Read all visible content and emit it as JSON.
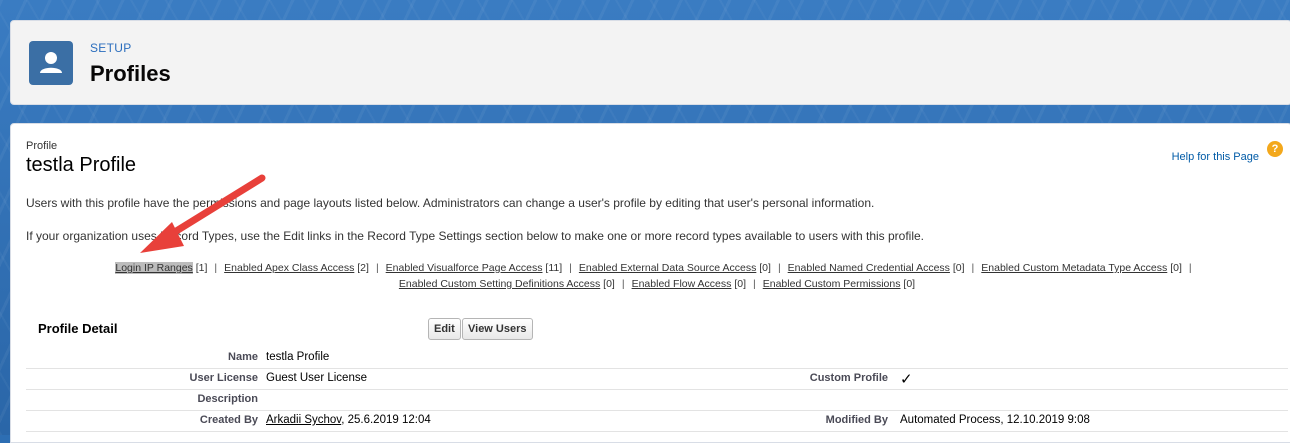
{
  "header": {
    "setup_label": "SETUP",
    "title": "Profiles",
    "icon": "user-icon"
  },
  "profile": {
    "label": "Profile",
    "name": "testla Profile",
    "help_link": "Help for this Page",
    "help_icon": "?"
  },
  "descriptions": [
    "Users with this profile have the permissions and page layouts listed below. Administrators can change a user's profile by editing that user's personal information.",
    "If your organization uses Record Types, use the Edit links in the Record Type Settings section below to make one or more record types available to users with this profile."
  ],
  "related_links": [
    {
      "label": "Login IP Ranges",
      "count": "[1]"
    },
    {
      "label": "Enabled Apex Class Access",
      "count": "[2]"
    },
    {
      "label": "Enabled Visualforce Page Access",
      "count": "[11]"
    },
    {
      "label": "Enabled External Data Source Access",
      "count": "[0]"
    },
    {
      "label": "Enabled Named Credential Access",
      "count": "[0]"
    },
    {
      "label": "Enabled Custom Metadata Type Access",
      "count": "[0]"
    },
    {
      "label": "Enabled Custom Setting Definitions Access",
      "count": "[0]"
    },
    {
      "label": "Enabled Flow Access",
      "count": "[0]"
    },
    {
      "label": "Enabled Custom Permissions",
      "count": "[0]"
    }
  ],
  "detail": {
    "title": "Profile Detail",
    "edit_button": "Edit",
    "view_users_button": "View Users",
    "rows": [
      {
        "label": "Name",
        "value": "testla Profile",
        "label2": "",
        "value2": ""
      },
      {
        "label": "User License",
        "value": "Guest User License",
        "label2": "Custom Profile",
        "value2": "✓"
      },
      {
        "label": "Description",
        "value": "",
        "label2": "",
        "value2": ""
      },
      {
        "label": "Created By",
        "value_link": "Arkadii Sychov",
        "value": ", 25.6.2019 12:04",
        "label2": "Modified By",
        "value2": "Automated Process, 12.10.2019 9:08"
      }
    ]
  },
  "colors": {
    "accent": "#2a6dbd",
    "arrow": "#e8403a",
    "help_icon": "#f3a81c"
  }
}
